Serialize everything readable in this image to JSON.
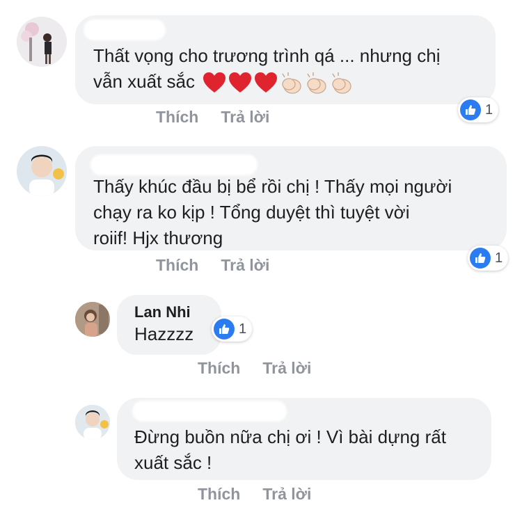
{
  "comments": [
    {
      "author": "",
      "lines": [
        "Thất vọng cho trương trình qá ... nhưng chị",
        "vẫn xuất sắc"
      ],
      "emoji": [
        "heart",
        "heart",
        "heart",
        "clap",
        "clap",
        "clap"
      ],
      "actions": {
        "like": "Thích",
        "reply": "Trả lời"
      },
      "reactions": {
        "icon": "like-icon",
        "count": "1"
      }
    },
    {
      "author": "",
      "lines": [
        "Thấy khúc đầu bị bể rồi chị ! Thấy mọi người",
        "chạy ra ko kịp ! Tổng duyệt thì tuyệt vời",
        "roiif! Hjx thương"
      ],
      "actions": {
        "like": "Thích",
        "reply": "Trả lời"
      },
      "reactions": {
        "icon": "like-icon",
        "count": "1"
      }
    },
    {
      "author": "Lan Nhi",
      "lines": [
        "Hazzzz"
      ],
      "actions": {
        "like": "Thích",
        "reply": "Trả lời"
      },
      "reactions": {
        "icon": "like-icon",
        "count": "1"
      }
    },
    {
      "author": "",
      "lines": [
        "Đừng buồn nữa chị ơi ! Vì bài dựng rất",
        "xuất sắc !"
      ],
      "actions": {
        "like": "Thích",
        "reply": "Trả lời"
      }
    }
  ],
  "colors": {
    "like_blue": "#2b7cf1",
    "heart_red": "#e0242f",
    "bubble": "#f1f2f4",
    "muted": "#90949c"
  }
}
